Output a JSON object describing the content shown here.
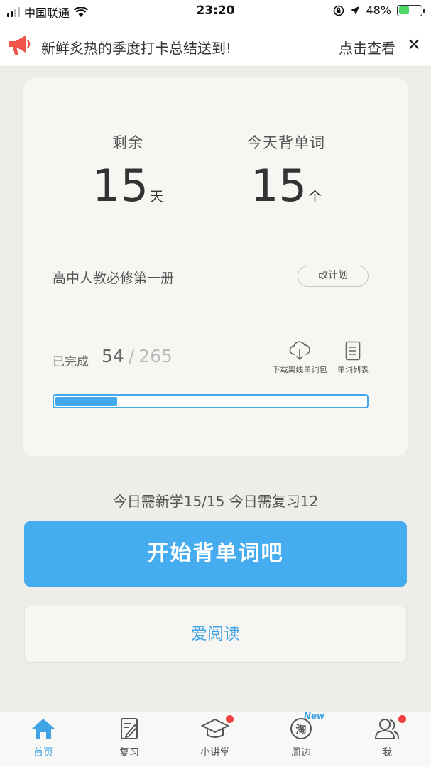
{
  "status_bar": {
    "carrier": "中国联通",
    "time": "23:20",
    "battery": "48%"
  },
  "notice": {
    "text": "新鲜炙热的季度打卡总结送到!",
    "link": "点击查看",
    "close": "✕"
  },
  "plan": {
    "remaining_label": "剩余",
    "remaining_value": "15",
    "remaining_unit": "天",
    "today_label": "今天背单词",
    "today_value": "15",
    "today_unit": "个",
    "book_name": "高中人教必修第一册",
    "change_plan": "改计划",
    "done_label": "已完成",
    "done_count": "54",
    "separator": "/",
    "total_count": "265",
    "progress": 0.2,
    "download_label": "下载离线单词包",
    "word_list_label": "单词列表"
  },
  "today_summary": "今日需新学15/15  今日需复习12",
  "buttons": {
    "start": "开始背单词吧",
    "read": "爱阅读"
  },
  "tabs": [
    {
      "label": "首页",
      "icon": "home-icon",
      "active": true
    },
    {
      "label": "复习",
      "icon": "review-icon"
    },
    {
      "label": "小讲堂",
      "icon": "lecture-icon",
      "badge": true
    },
    {
      "label": "周边",
      "icon": "taobao-icon",
      "new": "New"
    },
    {
      "label": "我",
      "icon": "profile-icon",
      "badge": true
    }
  ],
  "colors": {
    "accent": "#45acf0",
    "background": "#eeede8",
    "card": "#f7f6f2",
    "badge": "#f03e3e"
  }
}
